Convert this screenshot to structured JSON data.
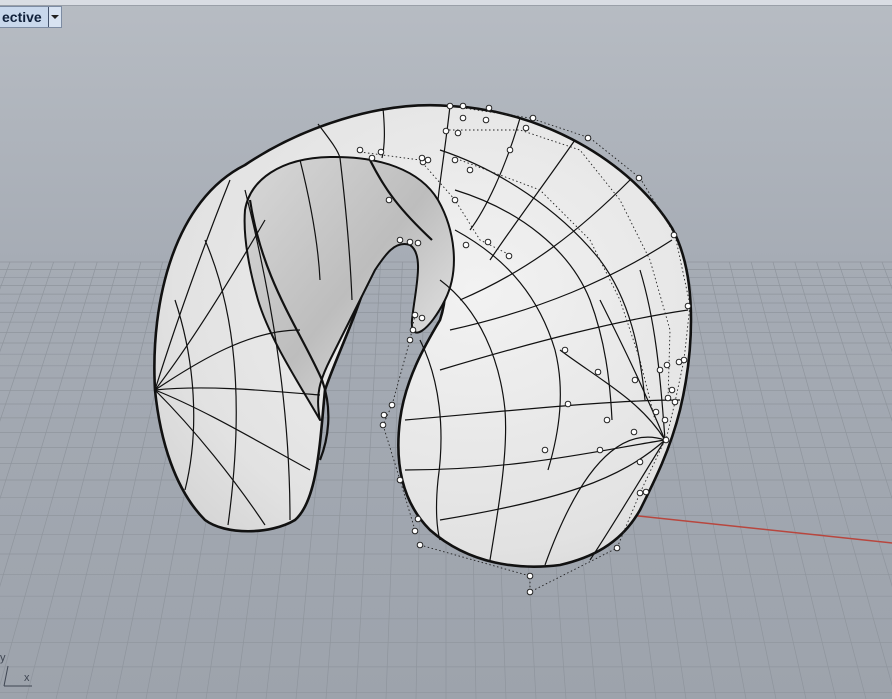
{
  "viewport": {
    "title": "ective",
    "menu_icon": "chevron-down-icon"
  },
  "axes": {
    "x_label": "x",
    "y_label": "y"
  },
  "colors": {
    "background": "#a5abb4",
    "grid_line": "#8d939b",
    "surface": "#e8e8e8",
    "x_axis": "#b8463e"
  }
}
